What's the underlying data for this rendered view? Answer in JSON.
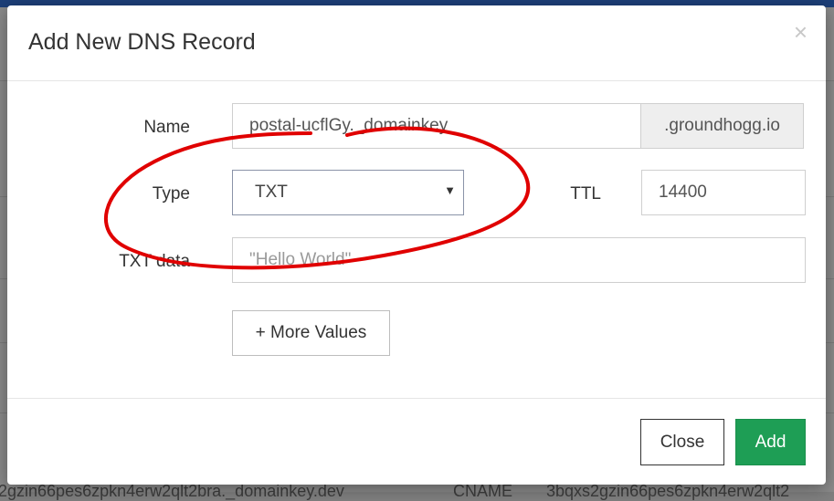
{
  "modal": {
    "title": "Add New DNS Record",
    "close_icon": "×"
  },
  "form": {
    "name_label": "Name",
    "name_value": "postal-ucflGy._domainkey",
    "domain_suffix": ".groundhogg.io",
    "type_label": "Type",
    "type_value": "TXT",
    "ttl_label": "TTL",
    "ttl_value": "14400",
    "txt_label": "TXT data",
    "txt_placeholder": "\"Hello World\"",
    "more_values_label": "+ More Values"
  },
  "footer": {
    "close_label": "Close",
    "add_label": "Add"
  },
  "background": {
    "bottom_row": [
      "2gzin66pes6zpkn4erw2qlt2bra._domainkey.dev",
      "CNAME",
      "3bqxs2gzin66pes6zpkn4erw2qlt2"
    ]
  },
  "colors": {
    "primary_green": "#1e9e55",
    "annotation_red": "#e00000"
  }
}
